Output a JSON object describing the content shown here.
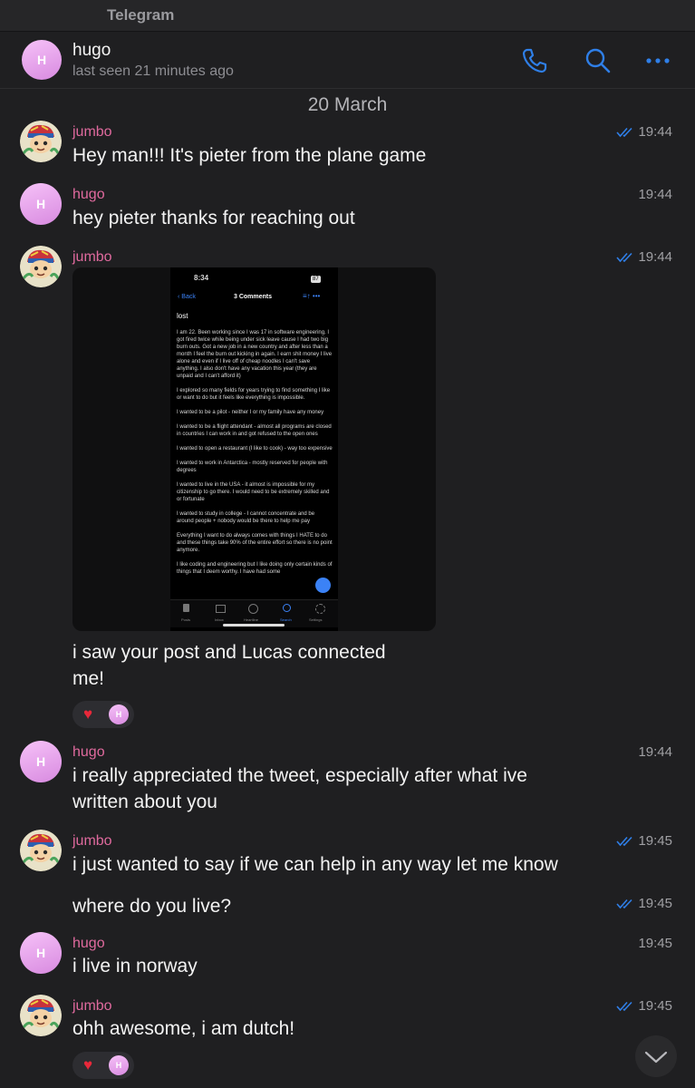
{
  "window": {
    "title": "Telegram"
  },
  "chat": {
    "name": "hugo",
    "avatar_letter": "H",
    "status": "last seen 21 minutes ago",
    "icons": [
      "phone-icon",
      "search-icon",
      "more-icon"
    ]
  },
  "date_divider": "20 March",
  "messages": [
    {
      "sender": "jumbo",
      "text": "Hey man!!! It's pieter from the plane game",
      "time": "19:44",
      "read": true
    },
    {
      "sender": "hugo",
      "text": "hey pieter thanks for reaching out",
      "time": "19:44",
      "read": false
    },
    {
      "sender": "jumbo",
      "text": "i saw your post and Lucas connected me!",
      "time": "19:44",
      "read": true,
      "has_photo": true,
      "reaction": "heart"
    },
    {
      "sender": "hugo",
      "text": "i really appreciated the tweet, especially after what ive written about you",
      "time": "19:44",
      "read": false
    },
    {
      "sender": "jumbo",
      "text": "i just wanted to say if we can help in any way let me know",
      "time": "19:45",
      "read": true
    },
    {
      "sender": "",
      "text": "where do you live?",
      "time": "19:45",
      "read": true
    },
    {
      "sender": "hugo",
      "text": "i live in norway",
      "time": "19:45",
      "read": false
    },
    {
      "sender": "jumbo",
      "text": "ohh awesome, i am dutch!",
      "time": "19:45",
      "read": true,
      "reaction": "heart"
    }
  ],
  "text_lines": {
    "m3_line1": "i saw your post and Lucas connected",
    "m3_line2": "me!",
    "m4_line1": "i really appreciated the tweet, especially after what ive",
    "m4_line2": "written about you"
  },
  "photo": {
    "status_time": "8:34",
    "battery": "87",
    "back": "Back",
    "title": "3 Comments",
    "heading": "lost",
    "paragraphs": [
      "I am 22. Been working since I was 17 in software engineering. I got fired twice while being under sick leave cause I had two big burn outs. Got a new job in a new country and after less than a month I feel the burn out kicking in again. I earn shit money I live alone and even if I live off of cheap noodles I can't save anything. I also don't have any vacation this year (they are unpaid and I can't afford it)",
      "I explored so many fields for years trying to find something I like or want to do but it feels like everything is impossible.",
      "I wanted to be a pilot - neither I or my family have any money",
      "I wanted to be a flight attendant - almost all programs are closed in countries I can work in and got refused to the open ones",
      "I wanted to open a restaurant (I like to cook) - way too expensive",
      "I wanted to work in Antarctica - mostly reserved for people with degrees",
      "I wanted to live in the USA - it almost is impossible for my citizenship to go there. I would need to be extremely skilled and or fortunate",
      "I wanted to study in college - I cannot concentrate and be around people + nobody would be there to help me pay",
      "Everything I want to do always comes with things I HATE to do and these things take 90% of the entire effort so there is no point anymore.",
      "I like coding and engineering but I like doing only certain kinds of things that I deem worthy. I have had some"
    ],
    "tabs": [
      "Posts",
      "Inbox",
      "Heartline",
      "Search",
      "Settings"
    ]
  },
  "colors": {
    "background": "#1f1f21",
    "sender_name": "#e06a9e",
    "accent_blue": "#2f7fe8",
    "reaction_heart": "#e8283a"
  }
}
